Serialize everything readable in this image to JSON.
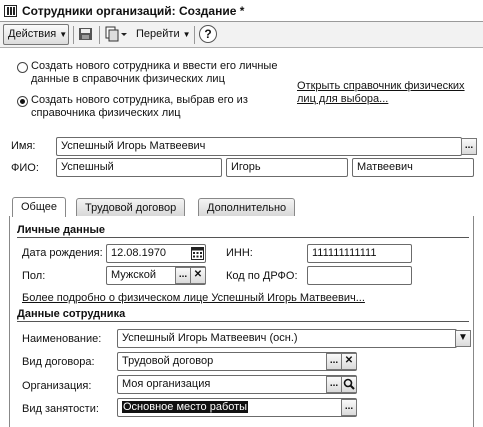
{
  "window": {
    "title": "Сотрудники организаций: Создание *"
  },
  "toolbar": {
    "actions_label": "Действия",
    "goto_label": "Перейти",
    "help_label": "?"
  },
  "mode": {
    "option_new": "Создать нового сотрудника и ввести его личные данные в справочник физических лиц",
    "option_select": "Создать нового сотрудника, выбрав его из справочника физических лиц",
    "open_directory_link": "Открыть справочник физических лиц для выбора...",
    "selected": "option_select"
  },
  "person": {
    "name_label": "Имя:",
    "name_value": "Успешный Игорь Матвеевич",
    "fio_label": "ФИО:",
    "last_name": "Успешный",
    "first_name": "Игорь",
    "patronymic": "Матвеевич"
  },
  "tabs": [
    {
      "label": "Общее",
      "active": true
    },
    {
      "label": "Трудовой договор",
      "active": false
    },
    {
      "label": "Дополнительно",
      "active": false
    }
  ],
  "personal": {
    "section_title": "Личные данные",
    "birth_label": "Дата рождения:",
    "birth_value": "12.08.1970",
    "inn_label": "ИНН:",
    "inn_value": "111111111111",
    "gender_label": "Пол:",
    "gender_value": "Мужской",
    "drfo_label": "Код по ДРФО:",
    "drfo_value": "",
    "details_link": "Более подробно о физическом лице Успешный Игорь Матвеевич..."
  },
  "employee": {
    "section_title": "Данные сотрудника",
    "name_label": "Наименование:",
    "name_value": "Успешный Игорь Матвеевич (осн.)",
    "contract_label": "Вид договора:",
    "contract_value": "Трудовой договор",
    "org_label": "Организация:",
    "org_value": "Моя организация",
    "employment_label": "Вид занятости:",
    "employment_value": "Основное место работы"
  }
}
